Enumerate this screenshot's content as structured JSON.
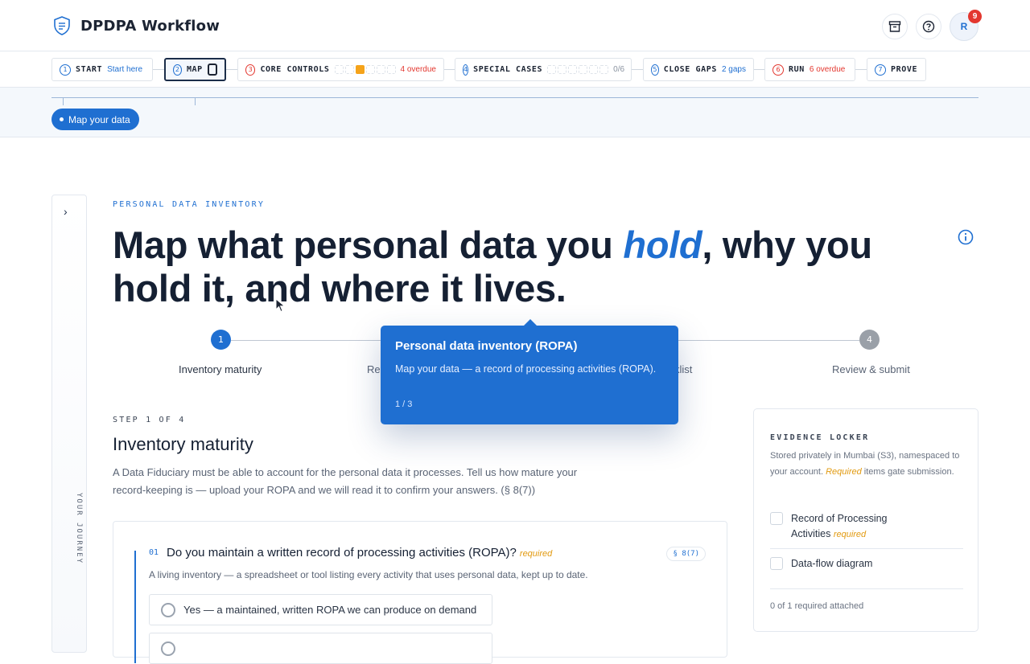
{
  "app": {
    "title": "DPDPA Workflow",
    "notifications": "9",
    "avatar_initial": "R"
  },
  "stepper": [
    {
      "num": "1",
      "label": "START",
      "sub": "Start here"
    },
    {
      "num": "2",
      "label": "MAP",
      "sub": ""
    },
    {
      "num": "3",
      "label": "CORE CONTROLS",
      "sub": "4 overdue"
    },
    {
      "num": "4",
      "label": "SPECIAL CASES",
      "sub": "0/6"
    },
    {
      "num": "5",
      "label": "CLOSE GAPS",
      "sub": "2 gaps"
    },
    {
      "num": "6",
      "label": "RUN",
      "sub": "6 overdue"
    },
    {
      "num": "7",
      "label": "PROVE",
      "sub": ""
    }
  ],
  "substep_pill": "Map your data",
  "journey_label": "YOUR JOURNEY",
  "page": {
    "eyebrow": "PERSONAL DATA INVENTORY",
    "headline_pre": "Map what personal data you ",
    "headline_em": "hold",
    "headline_post": ", why you hold it, and where it lives."
  },
  "progress": [
    {
      "num": "1",
      "label": "Inventory maturity"
    },
    {
      "num": "2",
      "label": "Rec"
    },
    {
      "num": "3",
      "label": "klist"
    },
    {
      "num": "4",
      "label": "Review & submit"
    }
  ],
  "step": {
    "of": "STEP 1 OF 4",
    "title": "Inventory maturity",
    "desc": "A Data Fiduciary must be able to account for the personal data it processes. Tell us how mature your record-keeping is — upload your ROPA and we will read it to confirm your answers. (§ 8(7))"
  },
  "question": {
    "num": "01",
    "text": "Do you maintain a written record of processing activities (ROPA)?",
    "required": "required",
    "ref": "§ 8(7)",
    "help": "A living inventory — a spreadsheet or tool listing every activity that uses personal data, kept up to date.",
    "options": [
      "Yes — a maintained, written ROPA we can produce on demand",
      ""
    ]
  },
  "locker": {
    "title": "EVIDENCE LOCKER",
    "desc_pre": "Stored privately in Mumbai (S3), namespaced to your account. ",
    "desc_em": "Required",
    "desc_post": " items gate submission.",
    "items": [
      {
        "label": "Record of Processing Activities",
        "tag": "required"
      },
      {
        "label": "Data-flow diagram",
        "tag": ""
      }
    ],
    "footer": "0 of 1 required attached"
  },
  "tooltip": {
    "title": "Personal data inventory (ROPA)",
    "body": "Map your data — a record of processing activities (ROPA).",
    "count": "1 / 3"
  },
  "colors": {
    "accent": "#1f6fd1",
    "danger": "#e3372f",
    "warning": "#f5a31a"
  }
}
